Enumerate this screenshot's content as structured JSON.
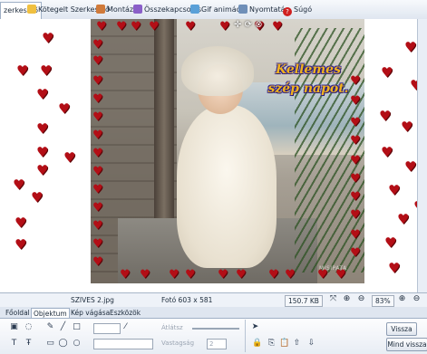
{
  "tabs": [
    {
      "label": "zerkesztő",
      "icon": "collage-editor-icon",
      "active": true
    },
    {
      "label": "Kötegelt Szerkesztő",
      "icon": "batch-editor-icon",
      "active": false
    },
    {
      "label": "Montázs",
      "icon": "montage-icon",
      "active": false
    },
    {
      "label": "Összekapcsolás",
      "icon": "combine-icon",
      "active": false
    },
    {
      "label": "Gif animáció",
      "icon": "gif-animation-icon",
      "active": false
    },
    {
      "label": "Nyomtatás",
      "icon": "print-icon",
      "active": false
    },
    {
      "label": "Súgó",
      "icon": "help-icon",
      "active": false
    }
  ],
  "image": {
    "greeting_line1": "Kellemes",
    "greeting_line2": "szép napot.",
    "signature": "MISIPATA"
  },
  "status": {
    "filename": "SZIVES 2.jpg",
    "photo_size": "Fotó 603 x 581",
    "file_size": "150.7 KB",
    "zoom": "83%"
  },
  "ribbon_tabs": [
    "Főoldal",
    "Objektum",
    "Kép vágása",
    "Eszközök"
  ],
  "ribbon_active_tab": "Objektum",
  "ribbon": {
    "opacity_label": "Átlátsz",
    "thickness_label": "Vastagság",
    "thickness_value": "2",
    "back_button": "Vissza",
    "all_back_button": "Mind vissza"
  },
  "colors": {
    "heart": "#b30e16",
    "greeting_text": "#f0b21e",
    "greeting_outline": "#3a2a90"
  }
}
